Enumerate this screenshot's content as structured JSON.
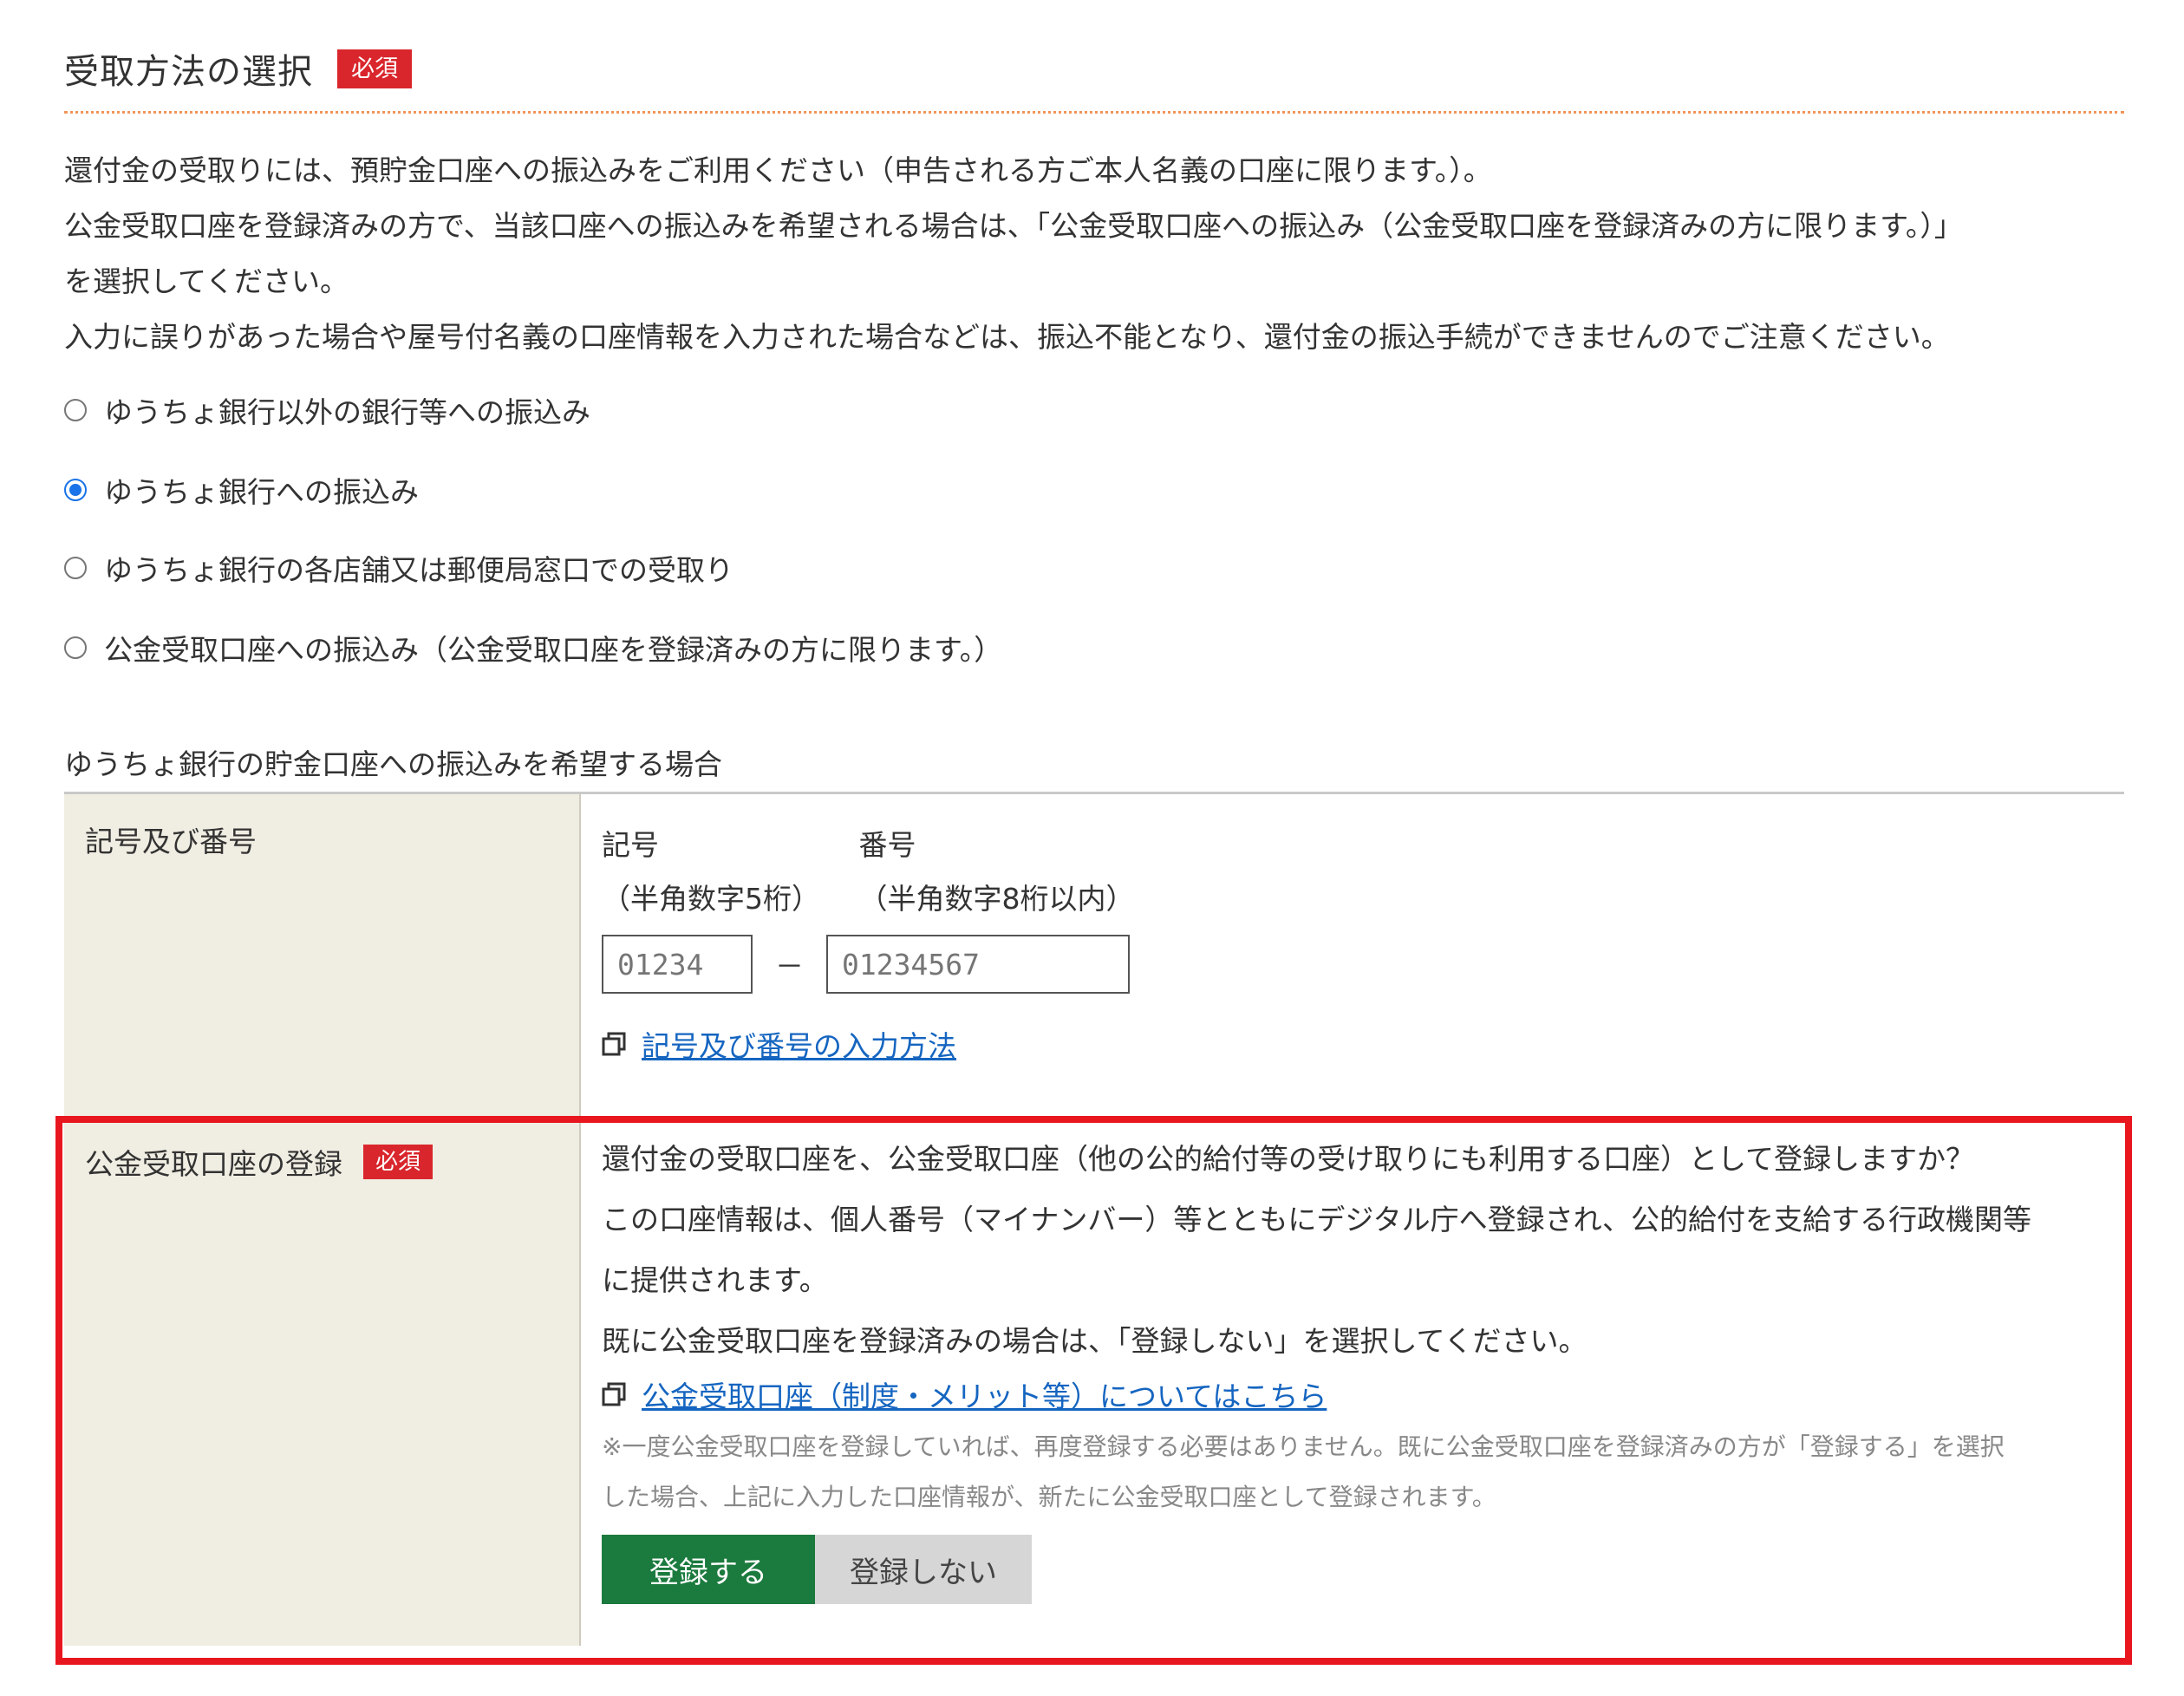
{
  "section": {
    "title": "受取方法の選択",
    "required_badge": "必須"
  },
  "intro_lines": [
    "還付金の受取りには、預貯金口座への振込みをご利用ください（申告される方ご本人名義の口座に限ります。）。",
    "公金受取口座を登録済みの方で、当該口座への振込みを希望される場合は、「公金受取口座への振込み（公金受取口座を登録済みの方に限ります。）」",
    "を選択してください。",
    "入力に誤りがあった場合や屋号付名義の口座情報を入力された場合などは、振込不能となり、還付金の振込手続ができませんのでご注意ください。"
  ],
  "methods": [
    {
      "label": "ゆうちょ銀行以外の銀行等への振込み",
      "selected": false
    },
    {
      "label": "ゆうちょ銀行への振込み",
      "selected": true
    },
    {
      "label": "ゆうちょ銀行の各店舗又は郵便局窓口での受取り",
      "selected": false
    },
    {
      "label": "公金受取口座への振込み（公金受取口座を登録済みの方に限ります。）",
      "selected": false
    }
  ],
  "yucho": {
    "heading": "ゆうちょ銀行の貯金口座への振込みを希望する場合",
    "row_label": "記号及び番号",
    "kigo_label": "記号",
    "kigo_hint": "（半角数字5桁）",
    "bango_label": "番号",
    "bango_hint": "（半角数字8桁以内）",
    "kigo_placeholder": "01234",
    "bango_placeholder": "01234567",
    "dash": "－",
    "help_link": "記号及び番号の入力方法"
  },
  "koukin": {
    "row_label": "公金受取口座の登録",
    "required_badge": "必須",
    "lines": [
      "還付金の受取口座を、公金受取口座（他の公的給付等の受け取りにも利用する口座）として登録しますか？",
      "この口座情報は、個人番号（マイナンバー）等とともにデジタル庁へ登録され、公的給付を支給する行政機関等",
      "に提供されます。",
      "既に公金受取口座を登録済みの場合は、「登録しない」を選択してください。"
    ],
    "info_link": "公金受取口座（制度・メリット等）についてはこちら",
    "note_lines": [
      "※一度公金受取口座を登録していれば、再度登録する必要はありません。既に公金受取口座を登録済みの方が「登録する」を選択",
      "した場合、上記に入力した口座情報が、新たに公金受取口座として登録されます。"
    ],
    "register_button": "登録する",
    "no_register_button": "登録しない"
  },
  "colors": {
    "required": "#d9262c",
    "highlight": "#e8171f",
    "primary_button": "#1b7a3d",
    "link": "#1565c0",
    "label_bg": "#f0ede2"
  }
}
